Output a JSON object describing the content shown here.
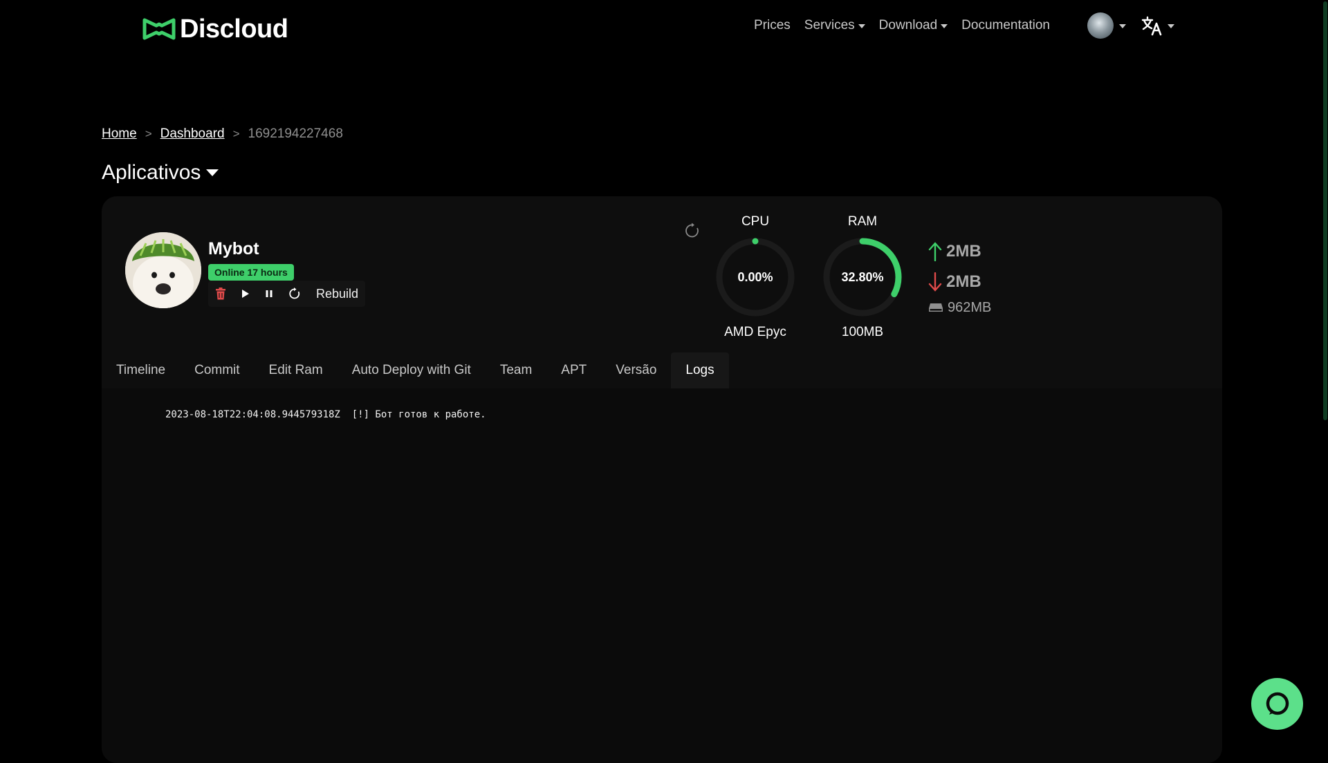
{
  "header": {
    "brand_name": "Discloud",
    "nav": [
      {
        "label": "Prices",
        "has_dropdown": false
      },
      {
        "label": "Services",
        "has_dropdown": true
      },
      {
        "label": "Download",
        "has_dropdown": true
      },
      {
        "label": "Documentation",
        "has_dropdown": false
      }
    ],
    "user_icon": "user-avatar",
    "language_icon": "translate-icon"
  },
  "breadcrumb": {
    "home": "Home",
    "dashboard": "Dashboard",
    "current": "1692194227468",
    "separator": ">"
  },
  "section": {
    "title": "Aplicativos"
  },
  "app": {
    "name": "Mybot",
    "status": "Online 17 hours",
    "status_color": "#3ecf6a",
    "actions": {
      "delete_icon": "trash-icon",
      "start_icon": "play-icon",
      "stop_icon": "pause-icon",
      "restart_icon": "restart-icon",
      "rebuild_label": "Rebuild"
    }
  },
  "metrics": {
    "cpu": {
      "label": "CPU",
      "value": "0.00%",
      "percent": 0,
      "sub": "AMD Epyc"
    },
    "ram": {
      "label": "RAM",
      "value": "32.80%",
      "percent": 32.8,
      "sub": "100MB"
    },
    "net_up": "2MB",
    "net_down": "2MB",
    "disk": "962MB",
    "accent": "#3ecf6a"
  },
  "tabs": [
    {
      "label": "Timeline",
      "active": false
    },
    {
      "label": "Commit",
      "active": false
    },
    {
      "label": "Edit Ram",
      "active": false
    },
    {
      "label": "Auto Deploy with Git",
      "active": false
    },
    {
      "label": "Team",
      "active": false
    },
    {
      "label": "APT",
      "active": false
    },
    {
      "label": "Versão",
      "active": false
    },
    {
      "label": "Logs",
      "active": true
    }
  ],
  "logs": {
    "lines": [
      "2023-08-18T22:04:08.944579318Z  [!] Бот готов к работе."
    ]
  },
  "chat": {
    "icon": "chat-icon"
  }
}
